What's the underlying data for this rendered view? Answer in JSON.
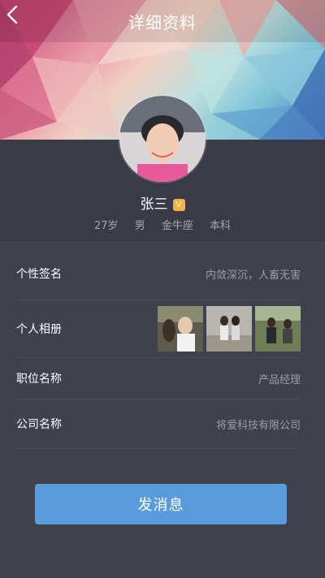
{
  "header": {
    "title": "详细资料"
  },
  "profile": {
    "name": "张三",
    "vip_badge": "V",
    "age": "27岁",
    "gender": "男",
    "zodiac": "金牛座",
    "education": "本科"
  },
  "details": {
    "signature_label": "个性签名",
    "signature_value": "内敛深沉，人畜无害",
    "album_label": "个人相册",
    "position_label": "职位名称",
    "position_value": "产品经理",
    "company_label": "公司名称",
    "company_value": "将爱科技有限公司"
  },
  "actions": {
    "send_message": "发消息"
  },
  "colors": {
    "background": "#3a3c47",
    "button": "#5a9bdc",
    "vip": "#f0b43a"
  }
}
